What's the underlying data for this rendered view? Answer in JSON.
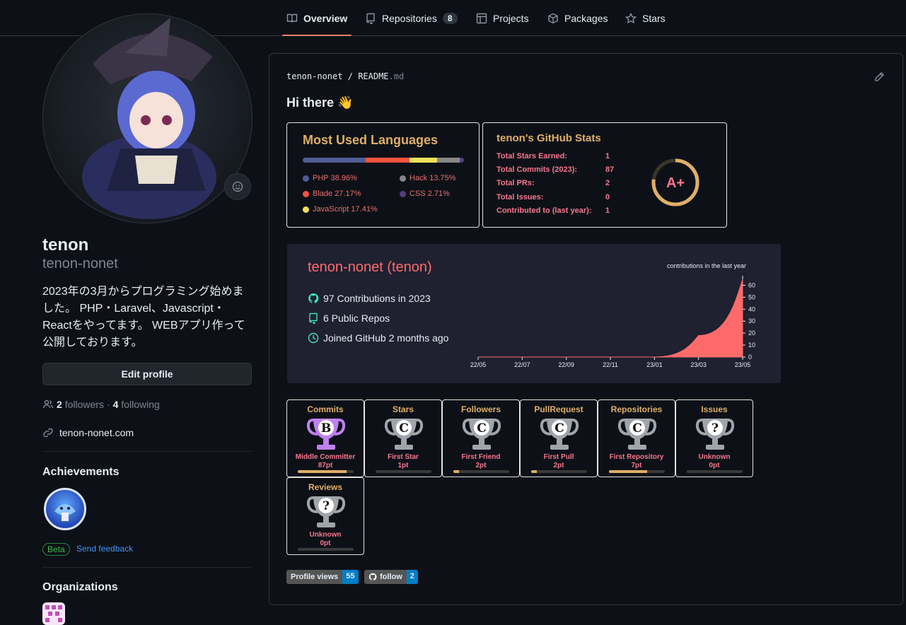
{
  "tabs": [
    {
      "label": "Overview",
      "icon": "book-icon"
    },
    {
      "label": "Repositories",
      "icon": "repo-icon",
      "count": "8"
    },
    {
      "label": "Projects",
      "icon": "table-icon"
    },
    {
      "label": "Packages",
      "icon": "package-icon"
    },
    {
      "label": "Stars",
      "icon": "star-icon"
    }
  ],
  "profile": {
    "name": "tenon",
    "login": "tenon-nonet",
    "bio": "2023年の3月からプログラミング始めました。 PHP・Laravel、Javascript・Reactをやってます。 WEBアプリ作って公開しております。",
    "edit_label": "Edit profile",
    "followers_count": "2",
    "followers_label": "followers",
    "following_count": "4",
    "following_label": "following",
    "separator": "·",
    "website": "tenon-nonet.com"
  },
  "achievements": {
    "title": "Achievements",
    "beta": "Beta",
    "feedback": "Send feedback"
  },
  "organizations": {
    "title": "Organizations"
  },
  "readme": {
    "path_user": "tenon-nonet",
    "path_sep": "/",
    "path_file": "README",
    "path_ext": ".md",
    "greeting": "Hi there 👋"
  },
  "languages_card": {
    "title": "Most Used Languages",
    "items": [
      {
        "label": "PHP 38.96%",
        "pct": 38.96,
        "color": "#4F5D95"
      },
      {
        "label": "Blade 27.17%",
        "pct": 27.17,
        "color": "#f7523f"
      },
      {
        "label": "JavaScript 17.41%",
        "pct": 17.41,
        "color": "#f1e05a"
      },
      {
        "label": "Hack 13.75%",
        "pct": 13.75,
        "color": "#878787"
      },
      {
        "label": "CSS 2.71%",
        "pct": 2.71,
        "color": "#563d7c"
      }
    ]
  },
  "stats_card": {
    "title": "tenon's GitHub Stats",
    "rows": [
      {
        "label": "Total Stars Earned:",
        "value": "1"
      },
      {
        "label": "Total Commits (2023):",
        "value": "87"
      },
      {
        "label": "Total PRs:",
        "value": "2"
      },
      {
        "label": "Total Issues:",
        "value": "0"
      },
      {
        "label": "Contributed to (last year):",
        "value": "1"
      }
    ],
    "grade": "A+"
  },
  "contrib_card": {
    "title": "tenon-nonet (tenon)",
    "contributions": "97 Contributions in 2023",
    "repos": "6 Public Repos",
    "joined": "Joined GitHub 2 months ago",
    "chart_label": "contributions in the last year"
  },
  "chart_data": {
    "type": "area",
    "title": "contributions in the last year",
    "x": [
      "22/05",
      "22/07",
      "22/09",
      "22/11",
      "23/01",
      "23/03",
      "23/05"
    ],
    "series": [
      {
        "values": [
          0,
          0,
          0,
          0,
          0,
          18,
          65
        ]
      }
    ],
    "yticks": [
      0,
      10,
      20,
      30,
      40,
      50,
      60
    ],
    "ylim": [
      0,
      65
    ],
    "color": "#ff6b6b"
  },
  "trophies": [
    {
      "title": "Commits",
      "rank": "B",
      "name": "Middle Committer",
      "points": "87pt",
      "progress": 0.87,
      "cup_color": "#c080f0"
    },
    {
      "title": "Stars",
      "rank": "C",
      "name": "First Star",
      "points": "1pt",
      "progress": 0.0,
      "cup_color": "#a0a4ab"
    },
    {
      "title": "Followers",
      "rank": "C",
      "name": "First Friend",
      "points": "2pt",
      "progress": 0.1,
      "cup_color": "#a0a4ab"
    },
    {
      "title": "PullRequest",
      "rank": "C",
      "name": "First Pull",
      "points": "2pt",
      "progress": 0.1,
      "cup_color": "#a0a4ab"
    },
    {
      "title": "Repositories",
      "rank": "C",
      "name": "First Repository",
      "points": "7pt",
      "progress": 0.68,
      "cup_color": "#a0a4ab"
    },
    {
      "title": "Issues",
      "rank": "?",
      "name": "Unknown",
      "points": "0pt",
      "progress": 0.0,
      "cup_color": "#a0a4ab"
    },
    {
      "title": "Reviews",
      "rank": "?",
      "name": "Unknown",
      "points": "0pt",
      "progress": 0.0,
      "cup_color": "#a0a4ab"
    }
  ],
  "shields": {
    "views_label": "Profile views",
    "views_value": "55",
    "follow_label": "follow",
    "follow_value": "2"
  }
}
